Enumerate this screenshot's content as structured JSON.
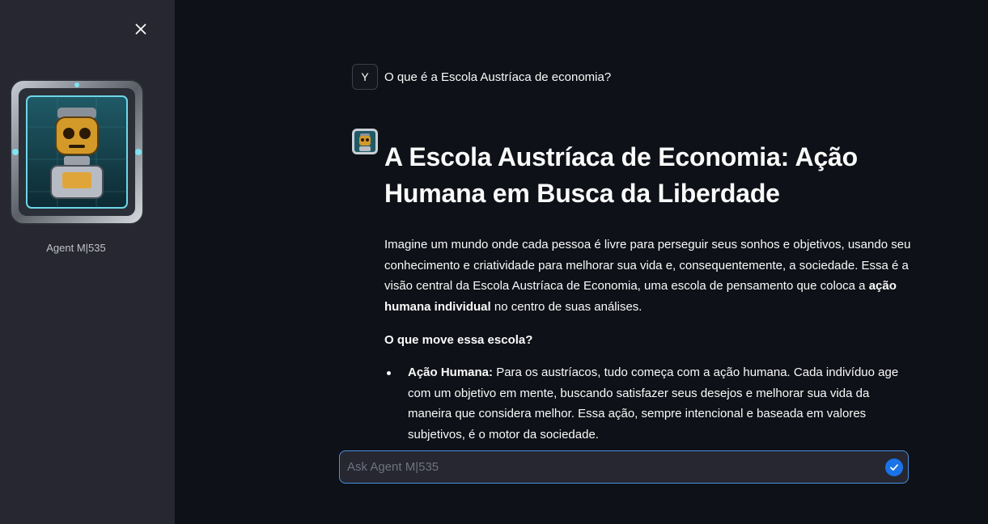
{
  "sidebar": {
    "agent_name": "Agent M|535"
  },
  "chat": {
    "user_avatar_letter": "Y",
    "user_message": "O que é a Escola Austríaca de economia?",
    "response": {
      "title": "A Escola Austríaca de Economia: Ação Humana em Busca da Liberdade",
      "intro_start": "Imagine um mundo onde cada pessoa é livre para perseguir seus sonhos e objetivos, usando seu conhecimento e criatividade para melhorar sua vida e, consequentemente, a sociedade. Essa é a visão central da Escola Austríaca de Economia, uma escola de pensamento que coloca a ",
      "intro_bold": "ação humana individual",
      "intro_end": " no centro de suas análises.",
      "subheading": "O que move essa escola?",
      "list": [
        {
          "bold": "Ação Humana:",
          "text": " Para os austríacos, tudo começa com a ação humana. Cada indivíduo age com um objetivo em mente, buscando satisfazer seus desejos e melhorar sua vida da maneira que considera melhor. Essa ação, sempre intencional e baseada em valores subjetivos, é o motor da sociedade."
        }
      ]
    }
  },
  "input": {
    "placeholder": "Ask Agent M|535"
  },
  "colors": {
    "background": "#0e1117",
    "sidebar": "#262730",
    "accent": "#1a73e8"
  }
}
